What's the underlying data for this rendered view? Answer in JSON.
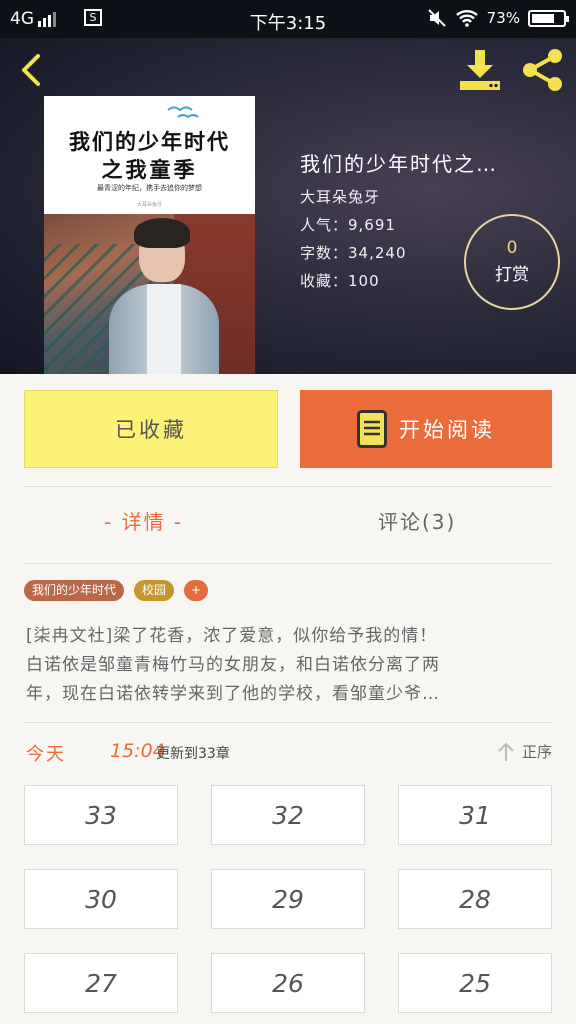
{
  "status_bar": {
    "network": "4G",
    "sim_label": "S",
    "time": "下午3:15",
    "battery": "73%",
    "battery_level": 0.73
  },
  "header": {
    "icons": [
      "back-icon",
      "download-icon",
      "share-icon"
    ]
  },
  "cover": {
    "title_line1": "我们的少年时代",
    "title_line2": "之我童季",
    "subtitle": "最青涩的年纪，携手去追你的梦想",
    "author": "大耳朵兔牙"
  },
  "book": {
    "title": "我们的少年时代之…",
    "author": "大耳朵兔牙",
    "popularity": "人气：9,691",
    "word_count": "字数：34,240",
    "favorites": "收藏：100"
  },
  "tip": {
    "count": "0",
    "label": "打赏"
  },
  "actions": {
    "favorite_label": "已收藏",
    "read_label": "开始阅读"
  },
  "tabs": {
    "detail": "- 详情 -",
    "comments": "评论(3)"
  },
  "tags": [
    "我们的少年时代",
    "校园",
    "+"
  ],
  "description": {
    "line1": "[柒冉文社]梁了花香，浓了爱意，似你给予我的情！",
    "line2": "白诺依是邹童青梅竹马的女朋友，和白诺依分离了两",
    "line3": "年，现在白诺依转学来到了他的学校，看邹童少爷…"
  },
  "update": {
    "day": "今天",
    "time": "15:04",
    "text": "更新到33章",
    "sort_label": "正序"
  },
  "chapters": [
    "33",
    "32",
    "31",
    "30",
    "29",
    "28",
    "27",
    "26",
    "25"
  ],
  "colors": {
    "accent": "#ea6c3b",
    "favorite_bg": "#fbf278",
    "tag_title": "#b9684a",
    "tag_campus": "#c6962c"
  }
}
